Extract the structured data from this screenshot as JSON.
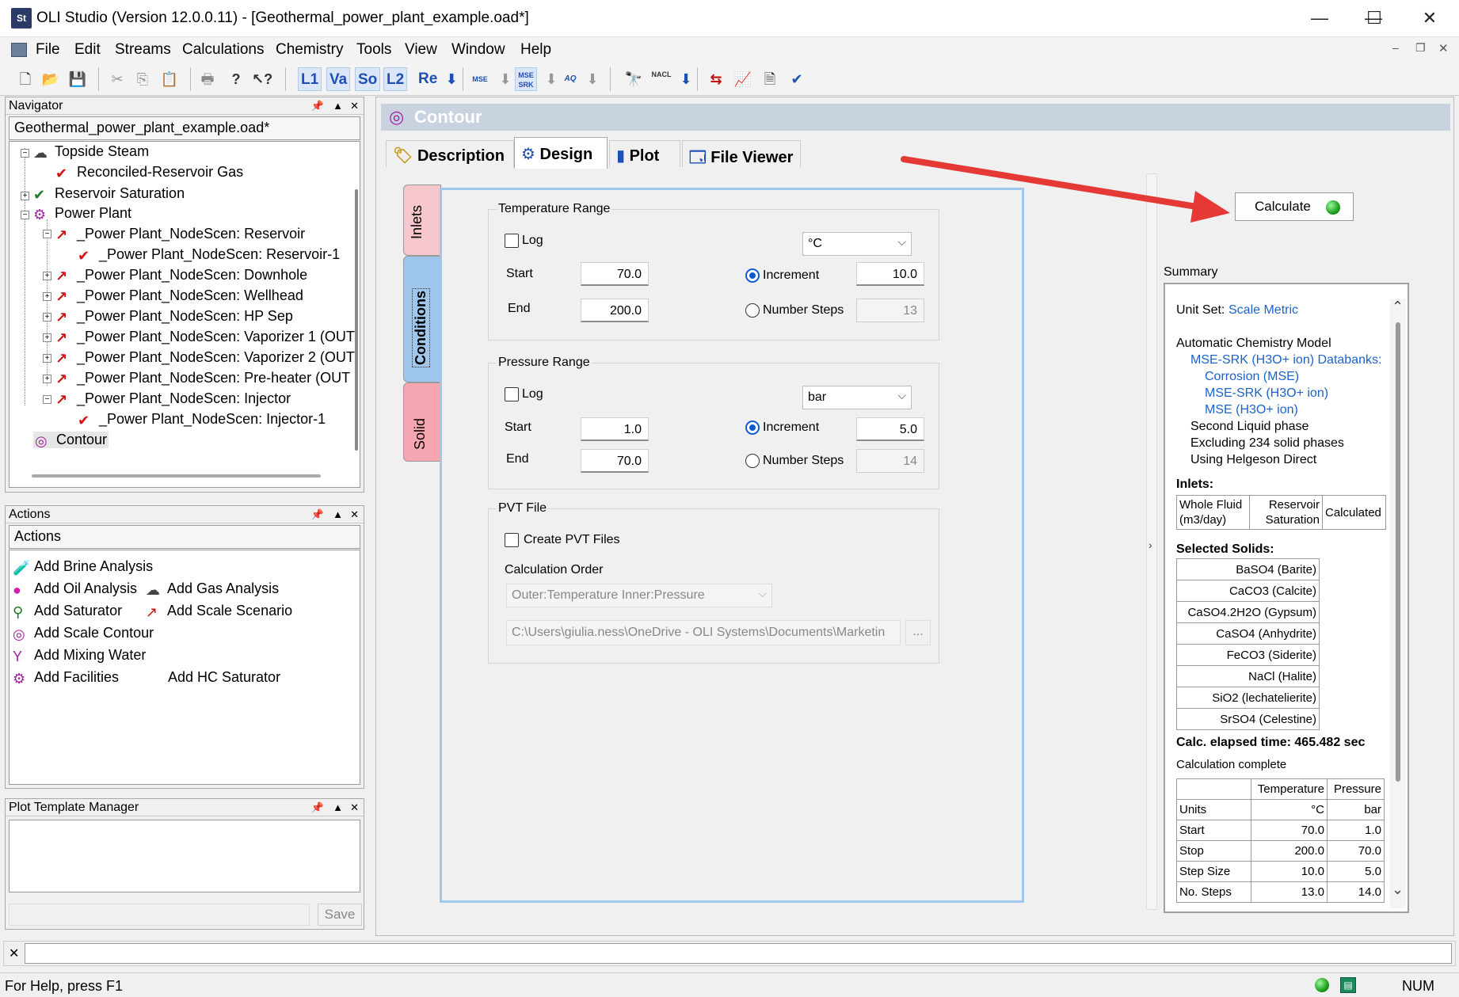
{
  "window": {
    "app_icon": "St",
    "title": "OLI Studio (Version 12.0.0.11) - [Geothermal_power_plant_example.oad*]",
    "minimize": "—",
    "maximize": "☐",
    "close": "✕"
  },
  "menu": [
    "File",
    "Edit",
    "Streams",
    "Calculations",
    "Chemistry",
    "Tools",
    "View",
    "Window",
    "Help"
  ],
  "toolbar": {
    "l1": "L1",
    "va": "Va",
    "so": "So",
    "l2": "L2",
    "re": "Re",
    "mse": "MSE",
    "mse_srk": "MSE SRK",
    "aq": "AQ",
    "nacl": "NACL"
  },
  "navigator": {
    "header": "Navigator",
    "file": "Geothermal_power_plant_example.oad*",
    "items": [
      {
        "label": "Topside Steam"
      },
      {
        "label": "Reconciled-Reservoir Gas"
      },
      {
        "label": "Reservoir Saturation"
      },
      {
        "label": "Power Plant"
      },
      {
        "label": "_Power Plant_NodeScen: Reservoir"
      },
      {
        "label": "_Power Plant_NodeScen: Reservoir-1"
      },
      {
        "label": "_Power Plant_NodeScen: Downhole"
      },
      {
        "label": "_Power Plant_NodeScen: Wellhead"
      },
      {
        "label": "_Power Plant_NodeScen: HP Sep"
      },
      {
        "label": "_Power Plant_NodeScen: Vaporizer 1 (OUT"
      },
      {
        "label": "_Power Plant_NodeScen: Vaporizer 2 (OUT"
      },
      {
        "label": "_Power Plant_NodeScen: Pre-heater (OUT"
      },
      {
        "label": "_Power Plant_NodeScen: Injector"
      },
      {
        "label": "_Power Plant_NodeScen: Injector-1"
      },
      {
        "label": "Contour"
      }
    ]
  },
  "actions": {
    "header": "Actions",
    "title": "Actions",
    "items": [
      "Add Brine Analysis",
      "Add Oil Analysis",
      "Add Gas Analysis",
      "Add Saturator",
      "Add Scale Scenario",
      "Add Scale Contour",
      "Add Mixing Water",
      "Add Facilities",
      "Add HC Saturator"
    ]
  },
  "plot_template": {
    "header": "Plot Template Manager",
    "save": "Save"
  },
  "contour": {
    "title": "Contour",
    "tabs": [
      "Description",
      "Design",
      "Plot",
      "File Viewer"
    ],
    "side_tabs": [
      "Inlets",
      "Conditions",
      "Solid"
    ],
    "calculate": "Calculate",
    "temperature": {
      "legend": "Temperature Range",
      "log": "Log",
      "unit": "°C",
      "start_label": "Start",
      "start": "70.0",
      "end_label": "End",
      "end": "200.0",
      "increment_label": "Increment",
      "increment": "10.0",
      "steps_label": "Number Steps",
      "steps": "13"
    },
    "pressure": {
      "legend": "Pressure Range",
      "log": "Log",
      "unit": "bar",
      "start_label": "Start",
      "start": "1.0",
      "end_label": "End",
      "end": "70.0",
      "increment_label": "Increment",
      "increment": "5.0",
      "steps_label": "Number Steps",
      "steps": "14"
    },
    "pvt": {
      "legend": "PVT File",
      "create": "Create PVT Files",
      "order_label": "Calculation Order",
      "order": "Outer:Temperature Inner:Pressure",
      "path": "C:\\Users\\giulia.ness\\OneDrive - OLI Systems\\Documents\\Marketin",
      "browse": "..."
    }
  },
  "summary": {
    "header": "Summary",
    "unit_set_label": "Unit Set:",
    "unit_set": "Scale Metric",
    "model": "Automatic Chemistry Model",
    "databanks": "MSE-SRK (H3O+ ion) Databanks:",
    "db1": "Corrosion (MSE)",
    "db2": "MSE-SRK (H3O+ ion)",
    "db3": "MSE (H3O+ ion)",
    "opt1": "Second Liquid phase",
    "opt2": "Excluding 234 solid phases",
    "opt3": "Using Helgeson Direct",
    "inlets_label": "Inlets:",
    "inlets": {
      "c1a": "Whole Fluid",
      "c1b": "(m3/day)",
      "c2a": "Reservoir",
      "c2b": "Saturation",
      "c3": "Calculated"
    },
    "solids_label": "Selected Solids:",
    "solids": [
      "BaSO4 (Barite)",
      "CaCO3 (Calcite)",
      "CaSO4.2H2O (Gypsum)",
      "CaSO4 (Anhydrite)",
      "FeCO3 (Siderite)",
      "NaCl (Halite)",
      "SiO2 (lechatelierite)",
      "SrSO4 (Celestine)"
    ],
    "elapsed": "Calc. elapsed time: 465.482 sec",
    "complete": "Calculation complete",
    "table": {
      "headers": [
        "",
        "Temperature",
        "Pressure"
      ],
      "rows": [
        [
          "Units",
          "°C",
          "bar"
        ],
        [
          "Start",
          "70.0",
          "1.0"
        ],
        [
          "Stop",
          "200.0",
          "70.0"
        ],
        [
          "Step Size",
          "10.0",
          "5.0"
        ],
        [
          "No. Steps",
          "13.0",
          "14.0"
        ]
      ]
    }
  },
  "statusbar": {
    "help": "For Help, press F1",
    "num": "NUM"
  },
  "colors": {
    "accent": "#1c62c9",
    "arrow": "#e53935",
    "header_bar": "#c9d3e0"
  }
}
